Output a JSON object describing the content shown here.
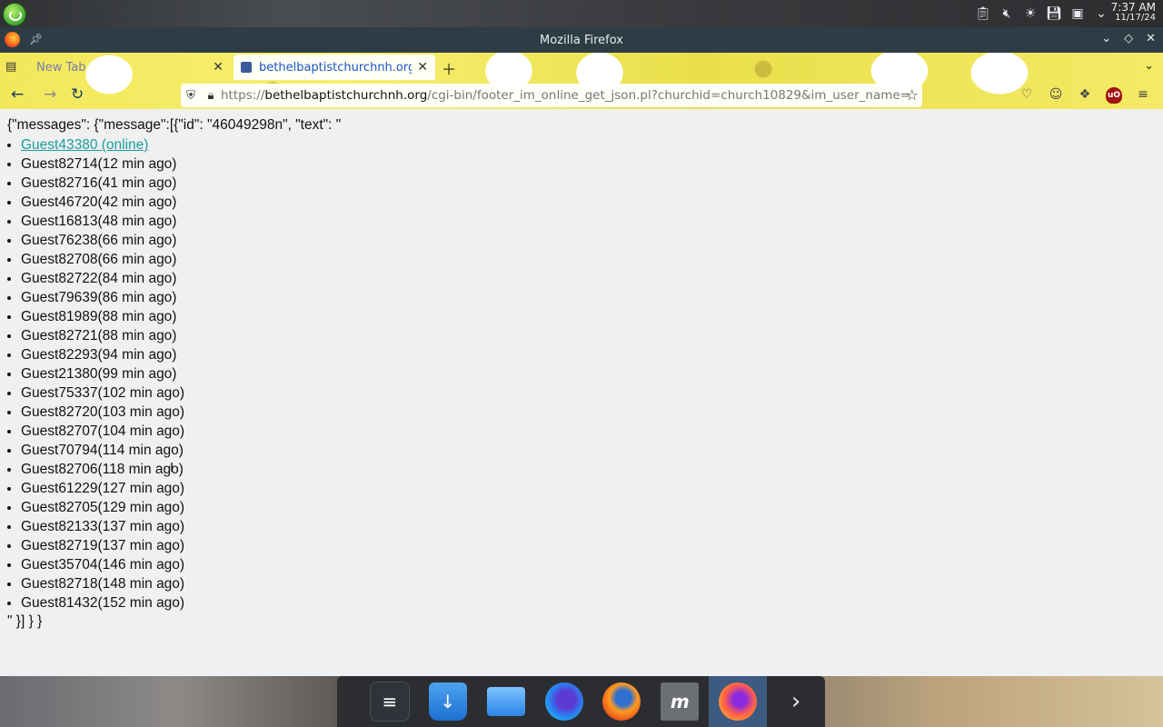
{
  "system_panel": {
    "time": "7:37 AM",
    "date": "11/17/24",
    "tray_icons": [
      "clipboard-icon",
      "volume-muted-icon",
      "brightness-icon",
      "save-icon",
      "display-icon",
      "chevron-down-icon"
    ]
  },
  "window": {
    "title": "Mozilla Firefox",
    "controls": [
      "minimize-icon",
      "maximize-icon",
      "close-icon"
    ]
  },
  "tabs": [
    {
      "label": "New Tab",
      "active": false
    },
    {
      "label": "bethelbaptistchurchnh.org/cgi-bin/footer_im_online_get_json.pl",
      "active": true
    }
  ],
  "toolbar": {
    "url_scheme": "https://",
    "url_host": "bethelbaptistchurchnh.org",
    "url_path": "/cgi-bin/footer_im_online_get_json.pl?churchid=church10829&im_user_name="
  },
  "page": {
    "json_head": "{\"messages\": {\"message\":[{\"id\": \"46049298n\", \"text\": \"",
    "json_tail": "\" }] } }",
    "guests": [
      "Guest43380 (online)",
      "Guest82714(12 min ago)",
      "Guest82716(41 min ago)",
      "Guest46720(42 min ago)",
      "Guest16813(48 min ago)",
      "Guest76238(66 min ago)",
      "Guest82708(66 min ago)",
      "Guest82722(84 min ago)",
      "Guest79639(86 min ago)",
      "Guest81989(88 min ago)",
      "Guest82721(88 min ago)",
      "Guest82293(94 min ago)",
      "Guest21380(99 min ago)",
      "Guest75337(102 min ago)",
      "Guest82720(103 min ago)",
      "Guest82707(104 min ago)",
      "Guest70794(114 min ago)",
      "Guest82706(118 min ago)",
      "Guest61229(127 min ago)",
      "Guest82705(129 min ago)",
      "Guest82133(137 min ago)",
      "Guest82719(137 min ago)",
      "Guest35704(146 min ago)",
      "Guest82718(148 min ago)",
      "Guest81432(152 min ago)"
    ]
  },
  "dock": {
    "items": [
      "settings-icon",
      "app-store-icon",
      "files-icon",
      "firefox-developer-icon",
      "firefox-icon",
      "text-editor-icon",
      "firefox-nightly-icon",
      "chevron-right-icon"
    ],
    "active_index": 6
  },
  "colors": {
    "link": "#1b9e9a",
    "page_bg": "#eff0f1",
    "titlebar": "#2e3d45",
    "theme_yellow": "#f2e85a"
  }
}
